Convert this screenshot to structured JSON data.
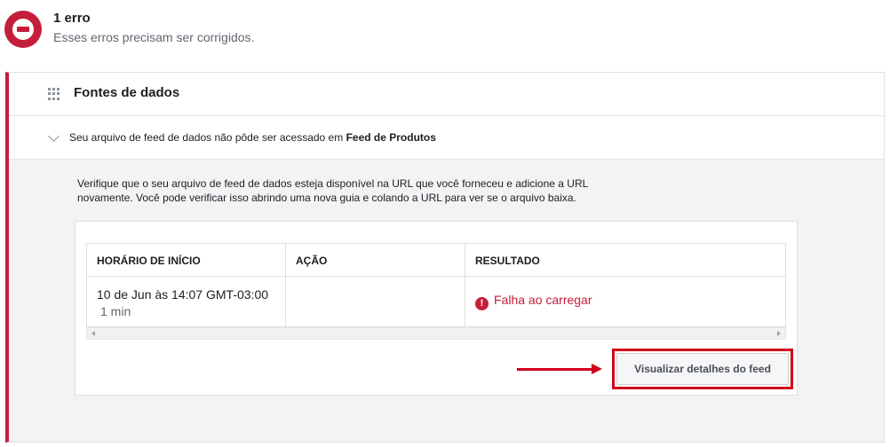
{
  "header": {
    "title": "1 erro",
    "subtitle": "Esses erros precisam ser corrigidos.",
    "icon": "error-stop-icon",
    "accent_color": "#c41e3a"
  },
  "section": {
    "title": "Fontes de dados",
    "icon": "drag-grip-icon"
  },
  "issue": {
    "text": "Seu arquivo de feed de dados não pôde ser acessado em ",
    "target": "Feed de Produtos"
  },
  "description": "Verifique que o seu arquivo de feed de dados esteja disponível na URL que você forneceu e adicione a URL novamente. Você pode verificar isso abrindo uma nova guia e colando a URL para ver se o arquivo baixa.",
  "table": {
    "columns": [
      "HORÁRIO DE INÍCIO",
      "AÇÃO",
      "RESULTADO"
    ],
    "rows": [
      {
        "start_time": "10 de Jun às 14:07 GMT-03:00",
        "duration": "1 min",
        "action": "",
        "result": "Falha ao carregar"
      }
    ]
  },
  "button": {
    "label": "Visualizar detalhes do feed"
  },
  "annotation": {
    "color": "#d0021b"
  }
}
